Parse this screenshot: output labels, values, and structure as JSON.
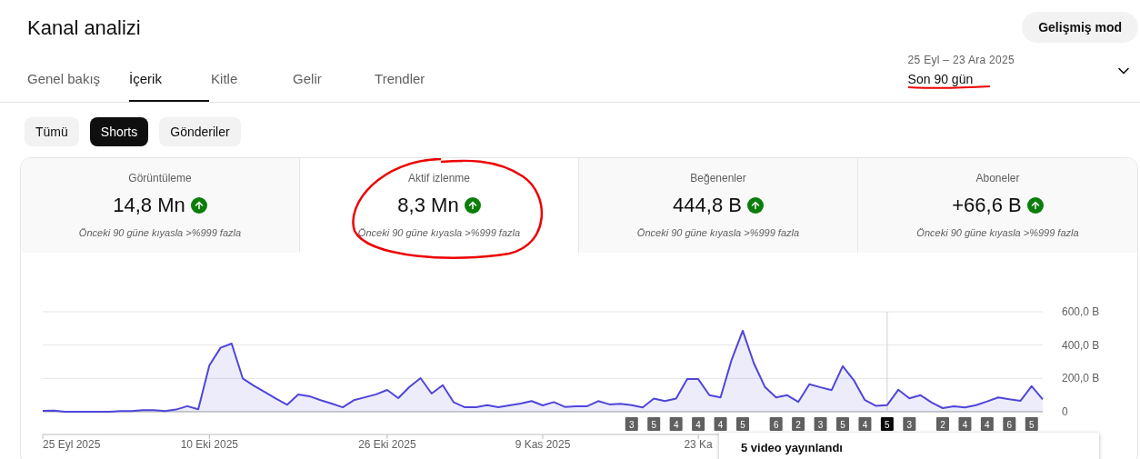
{
  "page_title": "Kanal analizi",
  "advanced_button": "Gelişmiş mod",
  "tabs": [
    {
      "label": "Genel bakış",
      "selected": false
    },
    {
      "label": "İçerik",
      "selected": true
    },
    {
      "label": "Kitle",
      "selected": false
    },
    {
      "label": "Gelir",
      "selected": false
    },
    {
      "label": "Trendler",
      "selected": false
    }
  ],
  "date_range": {
    "dates": "25 Eyl – 23 Ara 2025",
    "period": "Son 90 gün"
  },
  "filters": [
    {
      "label": "Tümü",
      "selected": false
    },
    {
      "label": "Shorts",
      "selected": true
    },
    {
      "label": "Gönderiler",
      "selected": false
    }
  ],
  "metrics": [
    {
      "label": "Görüntüleme",
      "value": "14,8 Mn",
      "note": "Önceki 90 güne kıyasla >%999 fazla",
      "selected": false
    },
    {
      "label": "Aktif izlenme",
      "value": "8,3 Mn",
      "note": "Önceki 90 güne kıyasla >%999 fazla",
      "selected": true
    },
    {
      "label": "Beğenenler",
      "value": "444,8 B",
      "note": "Önceki 90 güne kıyasla >%999 fazla",
      "selected": false
    },
    {
      "label": "Aboneler",
      "value": "+66,6 B",
      "note": "Önceki 90 güne kıyasla >%999 fazla",
      "selected": false
    }
  ],
  "chart_data": {
    "type": "area",
    "ylim": [
      0,
      600
    ],
    "yticks": [
      {
        "value": 0,
        "label": "0"
      },
      {
        "value": 200,
        "label": "200,0 B"
      },
      {
        "value": 400,
        "label": "400,0 B"
      },
      {
        "value": 600,
        "label": "600,0 B"
      }
    ],
    "series": [
      {
        "color": "#4f46d8",
        "values": [
          5,
          7,
          0,
          0,
          0,
          0,
          0,
          4,
          4,
          9,
          9,
          4,
          13,
          33,
          15,
          278,
          384,
          409,
          200,
          156,
          118,
          78,
          42,
          104,
          93,
          69,
          49,
          27,
          69,
          87,
          104,
          131,
          82,
          149,
          202,
          109,
          160,
          56,
          27,
          27,
          40,
          27,
          38,
          49,
          64,
          38,
          58,
          29,
          33,
          33,
          64,
          44,
          48,
          40,
          26,
          79,
          64,
          79,
          196,
          196,
          99,
          86,
          312,
          486,
          292,
          149,
          86,
          99,
          59,
          165,
          147,
          130,
          273,
          189,
          70,
          35,
          40,
          132,
          81,
          99,
          55,
          22,
          33,
          26,
          40,
          62,
          86,
          75,
          66,
          154,
          75
        ]
      }
    ]
  },
  "x_axis_labels": [
    "25 Eyl 2025",
    "10 Eki 2025",
    "26 Eki 2025",
    "9 Kas 2025",
    "23 Ka"
  ],
  "video_markers": [
    {
      "count": "3",
      "selected": false
    },
    {
      "count": "5",
      "selected": false
    },
    {
      "count": "4",
      "selected": false
    },
    {
      "count": "4",
      "selected": false
    },
    {
      "count": "4",
      "selected": false
    },
    {
      "count": "5",
      "selected": false
    },
    {
      "count": "6",
      "selected": false
    },
    {
      "count": "2",
      "selected": false
    },
    {
      "count": "3",
      "selected": false
    },
    {
      "count": "5",
      "selected": false
    },
    {
      "count": "4",
      "selected": false
    },
    {
      "count": "5",
      "selected": true
    },
    {
      "count": "3",
      "selected": false
    },
    {
      "count": "2",
      "selected": false
    },
    {
      "count": "4",
      "selected": false
    },
    {
      "count": "4",
      "selected": false
    },
    {
      "count": "6",
      "selected": false
    },
    {
      "count": "5",
      "selected": false
    }
  ],
  "tooltip": {
    "title": "5 video yayınlandı"
  }
}
